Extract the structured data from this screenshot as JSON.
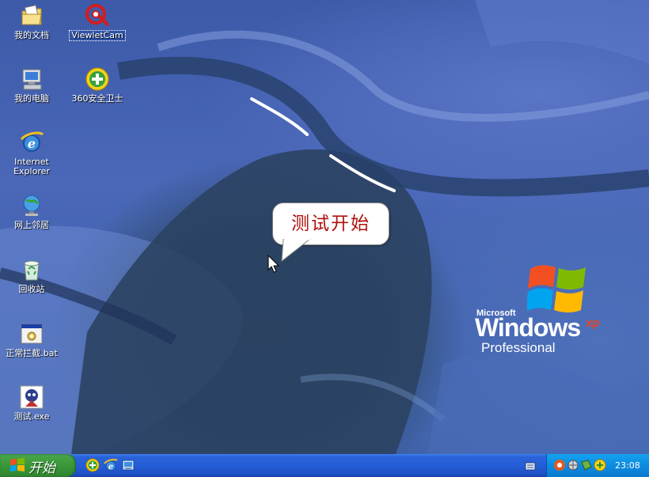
{
  "desktop_icons": [
    {
      "label": "我的文档",
      "icon": "my-documents-icon"
    },
    {
      "label": "ViewletCam",
      "icon": "viewletcam-icon",
      "selected": true
    },
    {
      "label": "我的电脑",
      "icon": "my-computer-icon"
    },
    {
      "label": "360安全卫士",
      "icon": "360-safeguard-icon"
    },
    {
      "label": "Internet\nExplorer",
      "icon": "internet-explorer-icon"
    },
    {
      "label": "网上邻居",
      "icon": "network-places-icon"
    },
    {
      "label": "回收站",
      "icon": "recycle-bin-icon"
    },
    {
      "label": "正常拦截.bat",
      "icon": "batch-file-icon"
    },
    {
      "label": "测试.exe",
      "icon": "executable-icon"
    }
  ],
  "callout": {
    "text": "测试开始"
  },
  "wallpaper_logo": {
    "brand": "Microsoft",
    "name": "Windows",
    "super": "xp",
    "edition": "Professional"
  },
  "taskbar": {
    "start_label": "开始",
    "quick_launch": [
      "360-quicklaunch-icon",
      "ie-quicklaunch-icon",
      "show-desktop-icon"
    ],
    "tray_icons": [
      "sound-tray-icon",
      "network-tray-icon",
      "security-tray-icon",
      "360-tray-icon"
    ],
    "clock": "23:08"
  },
  "colors": {
    "taskbar": "#245dd7",
    "start_button": "#3c9a3c",
    "tray": "#0c8be0",
    "callout_text": "#b01010"
  }
}
